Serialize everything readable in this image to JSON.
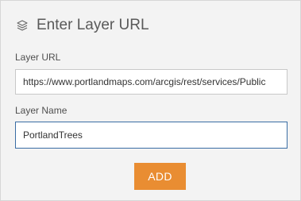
{
  "header": {
    "title": "Enter Layer URL",
    "icon": "layers-icon"
  },
  "form": {
    "url_label": "Layer URL",
    "url_value": "https://www.portlandmaps.com/arcgis/rest/services/Public",
    "name_label": "Layer Name",
    "name_value": "PortlandTrees"
  },
  "actions": {
    "add_label": "ADD"
  },
  "colors": {
    "panel_background": "#f3f3f3",
    "button_accent": "#e98d32",
    "focus_border": "#3a6da4"
  }
}
